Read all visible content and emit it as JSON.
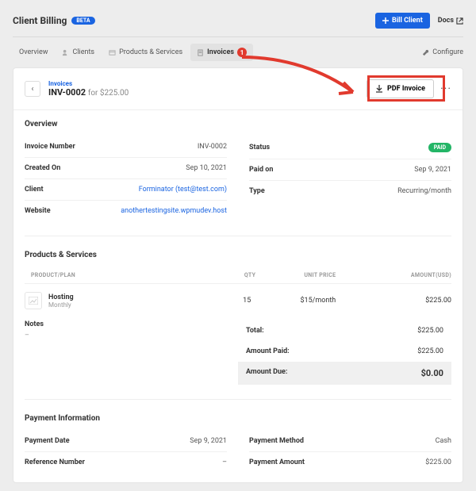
{
  "header": {
    "title": "Client Billing",
    "badge": "BETA",
    "bill_btn": "Bill Client",
    "docs": "Docs"
  },
  "tabs": {
    "overview": "Overview",
    "clients": "Clients",
    "products": "Products & Services",
    "invoices": "Invoices",
    "invoices_count": "1",
    "configure": "Configure"
  },
  "inv": {
    "breadcrumb": "Invoices",
    "number": "INV-0002",
    "for": "for $225.00",
    "pdf_btn": "PDF Invoice",
    "more": "···",
    "back": "‹"
  },
  "overview": {
    "heading": "Overview",
    "left": {
      "number_k": "Invoice Number",
      "number_v": "INV-0002",
      "created_k": "Created On",
      "created_v": "Sep 10, 2021",
      "client_k": "Client",
      "client_v": "Forminator (test@test.com)",
      "website_k": "Website",
      "website_v": "anothertestingsite.wpmudev.host"
    },
    "right": {
      "status_k": "Status",
      "status_v": "PAID",
      "paidon_k": "Paid on",
      "paidon_v": "Sep 9, 2021",
      "type_k": "Type",
      "type_v": "Recurring/month"
    }
  },
  "products": {
    "heading": "Products & Services",
    "cols": {
      "plan": "PRODUCT/PLAN",
      "qty": "QTY",
      "unit": "UNIT PRICE",
      "amount": "AMOUNT(USD)"
    },
    "item": {
      "name": "Hosting",
      "sub": "Monthly",
      "qty": "15",
      "unit": "$15/month",
      "amount": "$225.00"
    }
  },
  "notes": {
    "heading": "Notes",
    "value": "–"
  },
  "totals": {
    "total_k": "Total:",
    "total_v": "$225.00",
    "paid_k": "Amount Paid:",
    "paid_v": "$225.00",
    "due_k": "Amount Due:",
    "due_v": "$0.00"
  },
  "payment": {
    "heading": "Payment Information",
    "date_k": "Payment Date",
    "date_v": "Sep 9, 2021",
    "method_k": "Payment Method",
    "method_v": "Cash",
    "ref_k": "Reference Number",
    "ref_v": "–",
    "amount_k": "Payment Amount",
    "amount_v": "$225.00"
  }
}
